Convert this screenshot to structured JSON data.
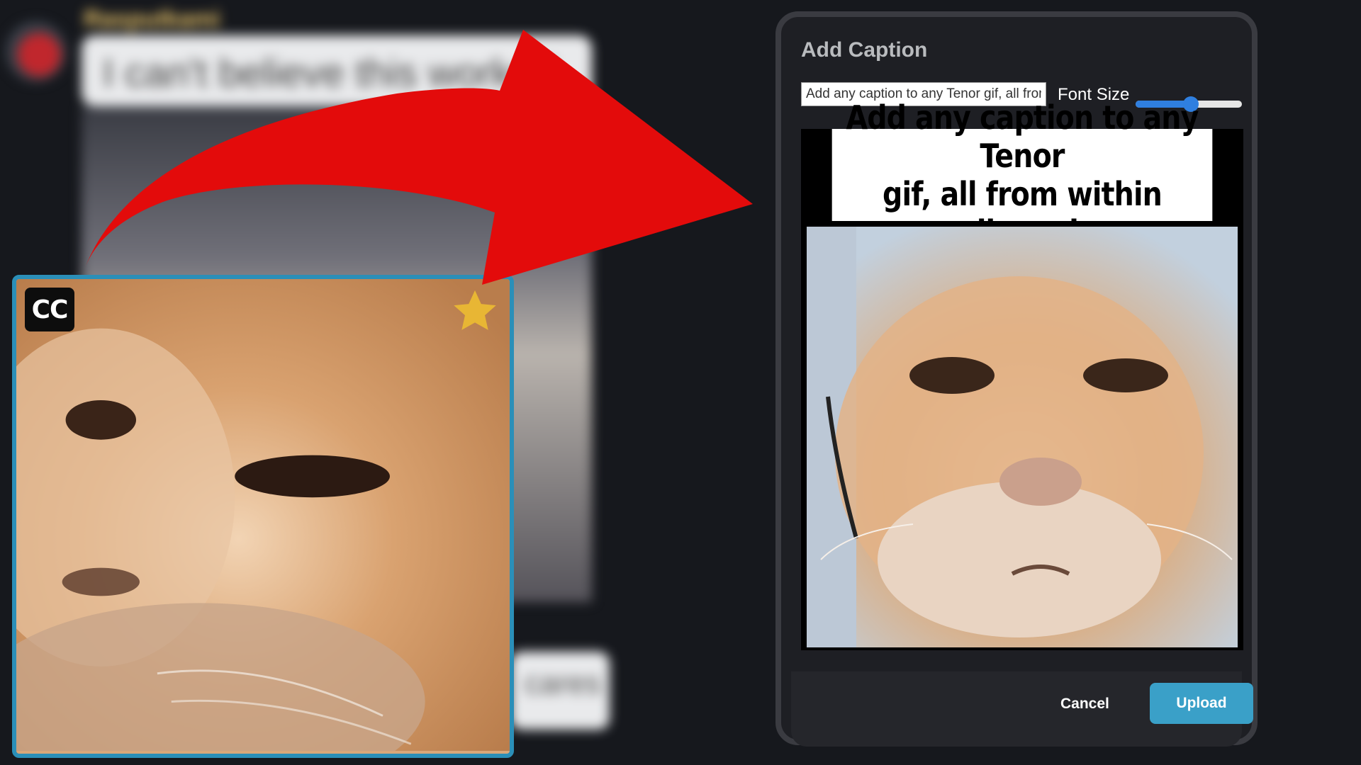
{
  "background_chat": {
    "username": "Rasputkami",
    "message": "I can't believe this worked",
    "reply_fragment": "cares"
  },
  "gif_card": {
    "cc_badge": "CC",
    "favorite_icon": "star-icon"
  },
  "arrow_icon": "curved-arrow-icon",
  "modal": {
    "title": "Add Caption",
    "caption_input_value": "Add any caption to any Tenor gif, all from within discord",
    "font_size_label": "Font Size",
    "font_size_value_fraction": 0.52,
    "preview_caption_line1": "Add any caption to any Tenor",
    "preview_caption_line2": "gif, all from within discord",
    "cancel_label": "Cancel",
    "upload_label": "Upload"
  },
  "colors": {
    "accent": "#3aa0c8",
    "arrow": "#e30b0b",
    "slider": "#2f7fe0",
    "card_border": "#2b8fb8"
  }
}
